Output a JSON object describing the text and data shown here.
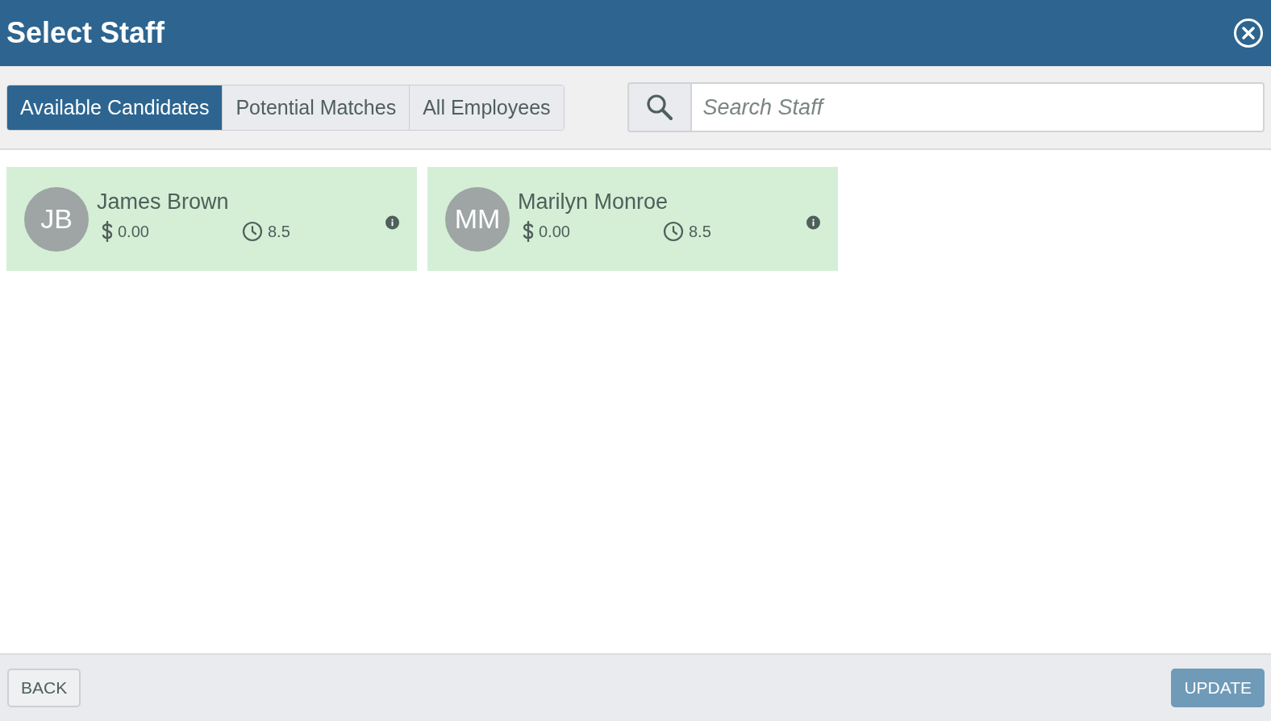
{
  "dialog": {
    "title": "Select Staff"
  },
  "tabs": [
    {
      "label": "Available Candidates",
      "selected": true
    },
    {
      "label": "Potential Matches",
      "selected": false
    },
    {
      "label": "All Employees",
      "selected": false
    }
  ],
  "search": {
    "placeholder": "Search Staff"
  },
  "candidates": [
    {
      "initials": "JB",
      "name": "James Brown",
      "rate": "0.00",
      "hours": "8.5"
    },
    {
      "initials": "MM",
      "name": "Marilyn Monroe",
      "rate": "0.00",
      "hours": "8.5"
    }
  ],
  "footer": {
    "back": "BACK",
    "update": {
      "label": "UPDATE",
      "disabled": true
    }
  }
}
